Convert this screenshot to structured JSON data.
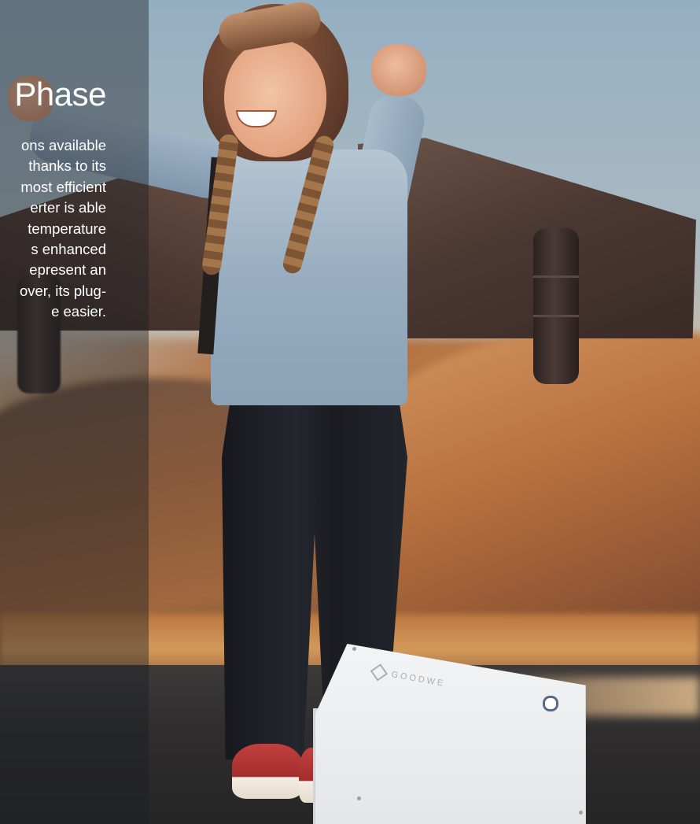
{
  "panel": {
    "title": "Phase",
    "body_lines": [
      "ons available",
      "thanks to its",
      "most efficient",
      "erter is able",
      "temperature",
      "s enhanced",
      "epresent an",
      "over, its plug-",
      "e easier."
    ]
  },
  "product": {
    "logo_text": "GOODWE"
  },
  "colors": {
    "panel_overlay": "#1a1e24",
    "text": "#ffffff",
    "inverter_led": "#586a8a"
  }
}
